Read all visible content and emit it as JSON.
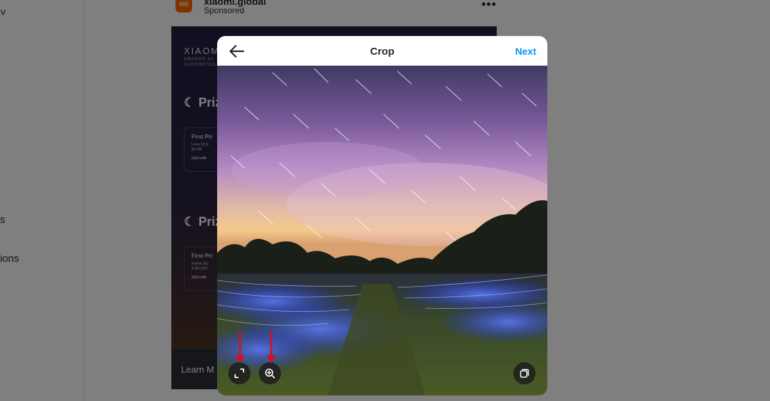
{
  "background_page": {
    "sidebar_fragments": [
      "s",
      "ions"
    ],
    "post": {
      "avatar_text": "mi",
      "username": "xiaomi.global",
      "sponsored": "Sponsored",
      "more": "•••",
      "ad": {
        "brand": "XIAOMI",
        "brand_sub": "AWARDS 20\nSUPPORTED B",
        "prize_1": "Priz",
        "prize_2": "Priz",
        "box_1": {
          "title": "First Pri",
          "sub": "Leica Q3 & \n$5,000",
          "offline": "2024 offli"
        },
        "box_2": {
          "title": "First Pri",
          "sub": "Xiaomi Stu\n& $10,000",
          "offline": "2024 offli"
        },
        "learn_more": "Learn M"
      }
    }
  },
  "modal": {
    "title": "Crop",
    "next_label": "Next",
    "icons": {
      "back": "arrow-left-icon",
      "aspect_ratio": "expand-icon",
      "zoom": "zoom-in-icon",
      "gallery": "multiple-pages-icon"
    },
    "annotation_color": "#e50914",
    "accent_color": "#0095f6"
  }
}
